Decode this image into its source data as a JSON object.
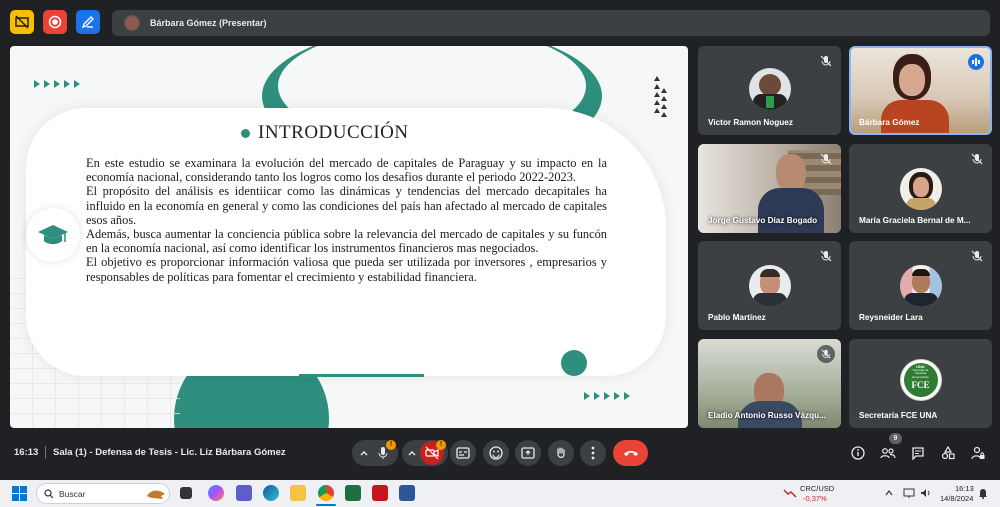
{
  "presenter": {
    "name": "Bárbara Gómez (Presentar)"
  },
  "slide": {
    "title": "INTRODUCCIÓN",
    "paragraphs": [
      "En este estudio se examinara la evolución del mercado de capitales de Paraguay y su impacto en la economía nacional, considerando tanto los logros como los desafios durante el periodo 2022-2023.",
      "El propósito del análisis es identiicar como las dinámicas y tendencias del mercado decapitales ha influido en la economía en general y como las condiciones del país han afectado al mercado de capitales esos años.",
      "Además, busca aumentar la conciencia pública sobre la relevancia del mercado de capitales y su funcón en la economía nacional, así como identificar los instrumentos financieros mas negociados.",
      "El objetivo es proporcionar información valiosa que pueda ser utilizada por inversores , empresarios y responsables de políticas para fomentar el crecimiento y estabilidad financiera."
    ]
  },
  "participants": [
    {
      "name": "Victor Ramon Noguez"
    },
    {
      "name": "Bárbara Gómez"
    },
    {
      "name": "Jorge Gustavo Díaz Bogado"
    },
    {
      "name": "María Graciela Bernal de M..."
    },
    {
      "name": "Pablo Martínez"
    },
    {
      "name": "Reysneider Lara"
    },
    {
      "name": "Eladio Antonio Russo Vázqu..."
    },
    {
      "name": "Secretaría FCE UNA"
    }
  ],
  "logo": {
    "top": "UNA",
    "lines": [
      "Facultad de",
      "Ciencias",
      "Económicas"
    ],
    "big": "FCE"
  },
  "meeting": {
    "time": "16:13",
    "title": "Sala (1) - Defensa de Tesis - Lic. Liz Bárbara Gómez",
    "people_count": "9"
  },
  "taskbar": {
    "search_placeholder": "Buscar",
    "stock_name": "CRC/USD",
    "stock_change": "-0,37%",
    "time": "16:13",
    "date": "14/8/2024"
  },
  "colors": {
    "accent_teal": "#2e8f7e",
    "end_call": "#ea4335",
    "warn_badge": "#f29900"
  }
}
